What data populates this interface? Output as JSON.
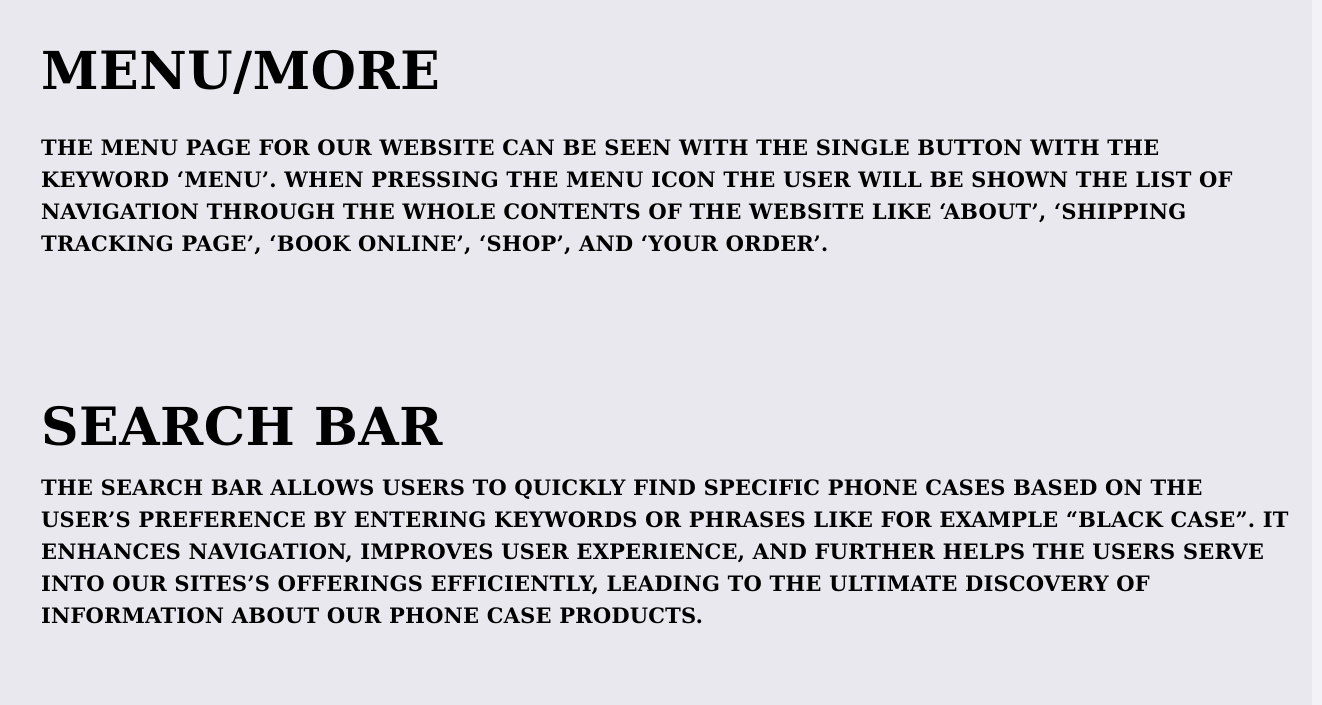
{
  "sections": {
    "menu": {
      "title": "MENU/MORE",
      "body": "THE MENU PAGE FOR OUR WEBSITE CAN BE SEEN WITH THE SINGLE BUTTON WITH THE KEYWORD ‘MENU’. WHEN PRESSING THE MENU ICON THE USER WILL BE SHOWN THE LIST OF NAVIGATION THROUGH THE WHOLE CONTENTS OF THE WEBSITE LIKE ‘ABOUT’, ‘SHIPPING TRACKING PAGE’, ‘BOOK ONLINE’, ‘SHOP’, AND ‘YOUR ORDER’."
    },
    "search": {
      "title": "SEARCH BAR",
      "body": "THE SEARCH BAR ALLOWS USERS TO QUICKLY FIND SPECIFIC PHONE CASES BASED ON THE USER’S PREFERENCE BY ENTERING KEYWORDS OR PHRASES LIKE FOR EXAMPLE “BLACK CASE”. IT ENHANCES NAVIGATION, IMPROVES USER EXPERIENCE, AND FURTHER HELPS THE USERS SERVE INTO OUR SITES’S OFFERINGS EFFICIENTLY, LEADING TO THE ULTIMATE DISCOVERY OF INFORMATION ABOUT OUR PHONE CASE PRODUCTS."
    }
  },
  "colors": {
    "background": "#e9e8ee",
    "text": "#000000"
  }
}
